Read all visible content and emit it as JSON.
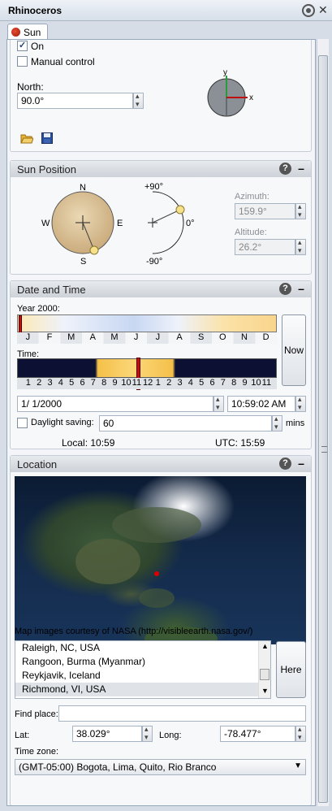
{
  "window": {
    "title": "Rhinoceros"
  },
  "tab": {
    "label": "Sun"
  },
  "general": {
    "on_label": "On",
    "manual_label": "Manual control",
    "north_label": "North:",
    "north_value": "90.0°",
    "compass_y": "y",
    "compass_x": "x"
  },
  "sun_position": {
    "title": "Sun Position",
    "dial": {
      "n": "N",
      "s": "S",
      "e": "E",
      "w": "W"
    },
    "alt_dial": {
      "top": "+90°",
      "mid": "0°",
      "bottom": "-90°"
    },
    "azimuth_label": "Azimuth:",
    "azimuth_value": "159.9°",
    "altitude_label": "Altitude:",
    "altitude_value": "26.2°"
  },
  "date_time": {
    "title": "Date and Time",
    "year_label": "Year 2000:",
    "months": [
      "J",
      "F",
      "M",
      "A",
      "M",
      "J",
      "J",
      "A",
      "S",
      "O",
      "N",
      "D"
    ],
    "time_label": "Time:",
    "hours": [
      "1",
      "2",
      "3",
      "4",
      "5",
      "6",
      "7",
      "8",
      "9",
      "10",
      "11",
      "12",
      "1",
      "2",
      "3",
      "4",
      "5",
      "6",
      "7",
      "8",
      "9",
      "10",
      "11"
    ],
    "now_label": "Now",
    "date_value": "1/  1/2000",
    "time_value": "10:59:02 AM",
    "daylight_label": "Daylight saving:",
    "daylight_value": "60",
    "mins_label": "mins",
    "local_label": "Local: 10:59",
    "utc_label": "UTC: 15:59"
  },
  "location": {
    "title": "Location",
    "credit": "Map images courtesy of NASA (http://visibleearth.nasa.gov/)",
    "places": [
      "Raleigh, NC, USA",
      "Rangoon, Burma (Myanmar)",
      "Reykjavik, Iceland",
      "Richmond, VI, USA"
    ],
    "selected_place": "Richmond, VI, USA",
    "here_label": "Here",
    "find_label": "Find place:",
    "find_value": "",
    "lat_label": "Lat:",
    "lat_value": "38.029°",
    "long_label": "Long:",
    "long_value": "-78.477°",
    "timezone_label": "Time zone:",
    "timezone_value": "(GMT-05:00) Bogota, Lima, Quito, Rio Branco"
  },
  "colors": {
    "accent_blue": "#21467a",
    "sun_dot": "#f7e08a",
    "marker_red": "#c01010",
    "year_bar_warm": "#f9d58d",
    "time_bar_night": "#0c1033",
    "time_bar_day": "#f4c04a"
  }
}
